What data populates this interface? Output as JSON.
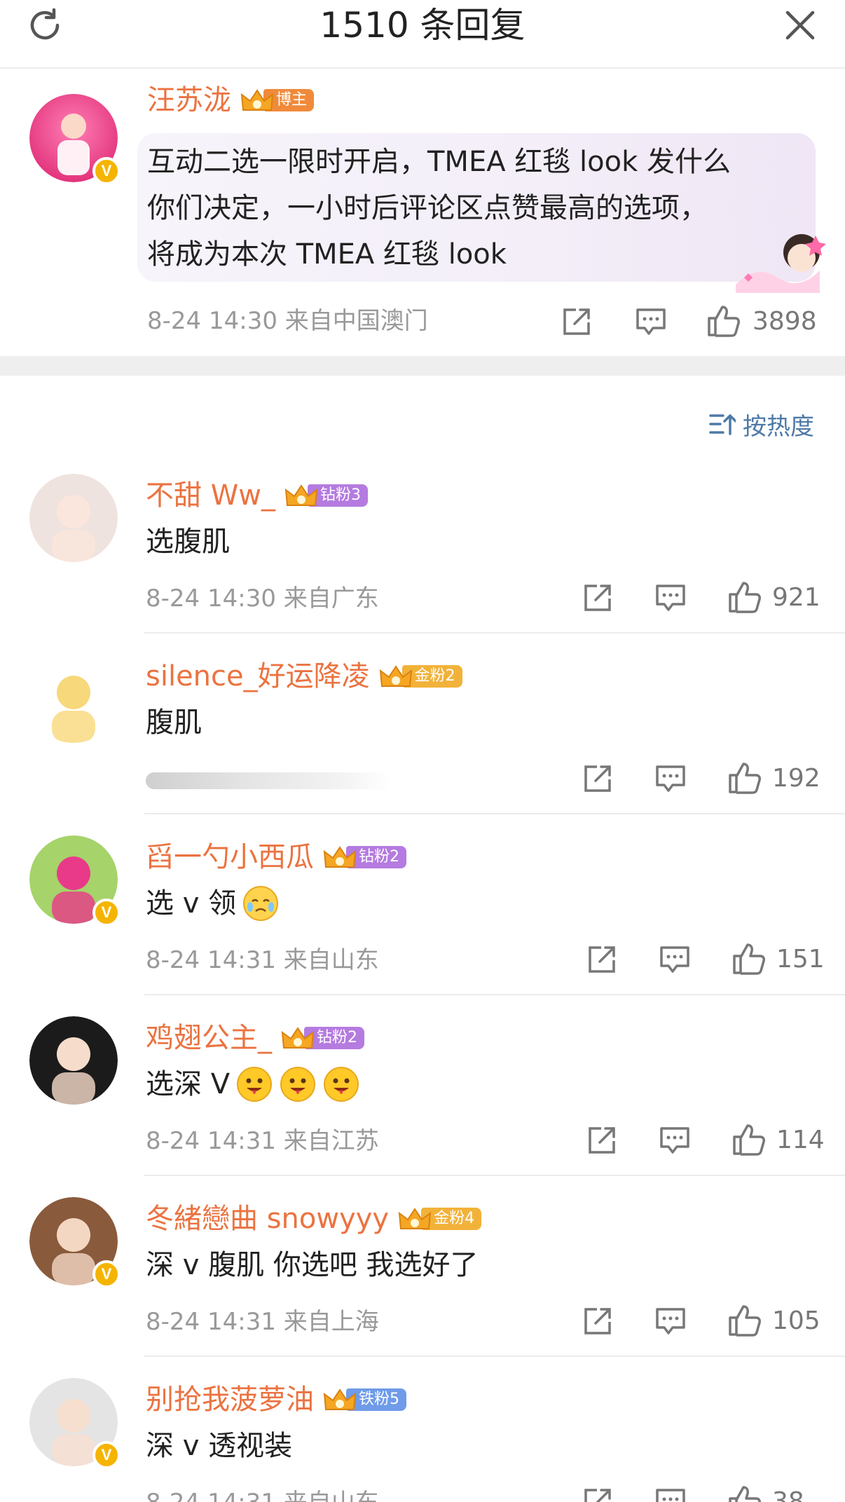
{
  "header": {
    "title": "1510 条回复",
    "refresh_icon": "refresh-icon",
    "close_icon": "close-icon"
  },
  "post": {
    "author": "汪苏泷",
    "badge_label": "博主",
    "badge_color": "#f08a3a",
    "text_lines": [
      "互动二选一限时开启，TMEA 红毯 look 发什么",
      "你们决定，一小时后评论区点赞最高的选项，",
      "将成为本次 TMEA 红毯 look"
    ],
    "meta": "8-24 14:30  来自中国澳门",
    "likes": "3898"
  },
  "sort": {
    "label": "按热度",
    "icon": "sort-icon"
  },
  "comments": [
    {
      "name": "不甜 Ww_",
      "badge": "钻粉3",
      "badge_color": "#b57be0",
      "text": "选腹肌",
      "meta": "8-24 14:30  来自广东",
      "likes": "921",
      "verified": false,
      "emojis": []
    },
    {
      "name": "silence_好运降凌",
      "badge": "金粉2",
      "badge_color": "#f2b23a",
      "text": "腹肌",
      "meta": "",
      "likes": "192",
      "verified": false,
      "emojis": []
    },
    {
      "name": "舀一勺小西瓜",
      "badge": "钻粉2",
      "badge_color": "#b57be0",
      "text": "选 v 领",
      "meta": "8-24 14:31  来自山东",
      "likes": "151",
      "verified": true,
      "emojis": [
        "cry-emoji"
      ]
    },
    {
      "name": "鸡翅公主_",
      "badge": "钻粉2",
      "badge_color": "#b57be0",
      "text": "选深 V",
      "meta": "8-24 14:31  来自江苏",
      "likes": "114",
      "verified": false,
      "emojis": [
        "drool-emoji",
        "drool-emoji",
        "drool-emoji"
      ]
    },
    {
      "name": "冬緒戀曲 snowyyy",
      "badge": "金粉4",
      "badge_color": "#f2b23a",
      "text": "深 v 腹肌 你选吧 我选好了",
      "meta": "8-24 14:31  来自上海",
      "likes": "105",
      "verified": true,
      "emojis": []
    },
    {
      "name": "别抢我菠萝油",
      "badge": "铁粉5",
      "badge_color": "#6f9be8",
      "text": "深 v 透视装",
      "meta": "8-24 14:31  来自山东",
      "likes": "38",
      "verified": true,
      "emojis": []
    }
  ]
}
